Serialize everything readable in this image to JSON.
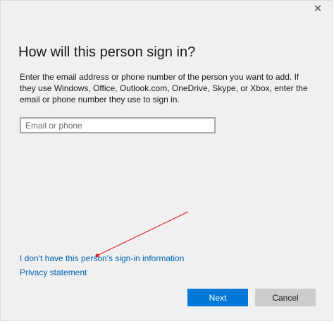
{
  "window": {
    "close_glyph": "✕"
  },
  "header": {
    "title": "How will this person sign in?"
  },
  "main": {
    "description": "Enter the email address or phone number of the person you want to add. If they use Windows, Office, Outlook.com, OneDrive, Skype, or Xbox, enter the email or phone number they use to sign in.",
    "email_input": {
      "value": "",
      "placeholder": "Email or phone"
    },
    "links": {
      "no_signin_info": "I don't have this person's sign-in information",
      "privacy": "Privacy statement"
    }
  },
  "footer": {
    "next_label": "Next",
    "cancel_label": "Cancel"
  },
  "colors": {
    "accent": "#0078d7",
    "link": "#0063b1",
    "annotation_arrow": "#d9232e"
  },
  "icons": {
    "close": "close-icon"
  }
}
